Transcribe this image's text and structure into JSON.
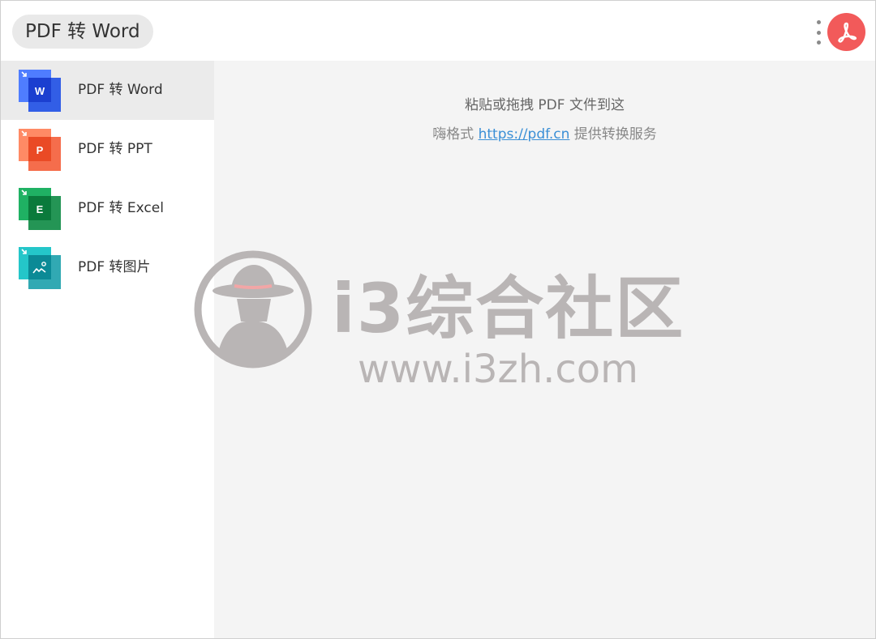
{
  "header": {
    "title": "PDF 转 Word",
    "more_icon": "more-vertical-icon",
    "app_icon": "acrobat-icon",
    "app_icon_color": "#f25a5a"
  },
  "sidebar": {
    "items": [
      {
        "label": "PDF 转 Word",
        "icon_letter": "W",
        "icon": "word-file-icon",
        "color_back": "#4f7dff",
        "color_front": "#1e4fe6",
        "active": true
      },
      {
        "label": "PDF 转 PPT",
        "icon_letter": "P",
        "icon": "ppt-file-icon",
        "color_back": "#ff8a65",
        "color_front": "#f3542d",
        "active": false
      },
      {
        "label": "PDF 转 Excel",
        "icon_letter": "E",
        "icon": "excel-file-icon",
        "color_back": "#1fb163",
        "color_front": "#0c8a43",
        "active": false
      },
      {
        "label": "PDF 转图片",
        "icon_letter": "",
        "icon": "image-file-icon",
        "color_back": "#24c6c9",
        "color_front": "#0d9aa6",
        "active": false
      }
    ]
  },
  "main": {
    "drop_hint": "粘贴或拖拽 PDF 文件到这",
    "provider_prefix": "嗨格式",
    "provider_link": "https://pdf.cn",
    "provider_suffix": "提供转换服务"
  },
  "watermark": {
    "name": "i3综合社区",
    "url": "www.i3zh.com"
  }
}
